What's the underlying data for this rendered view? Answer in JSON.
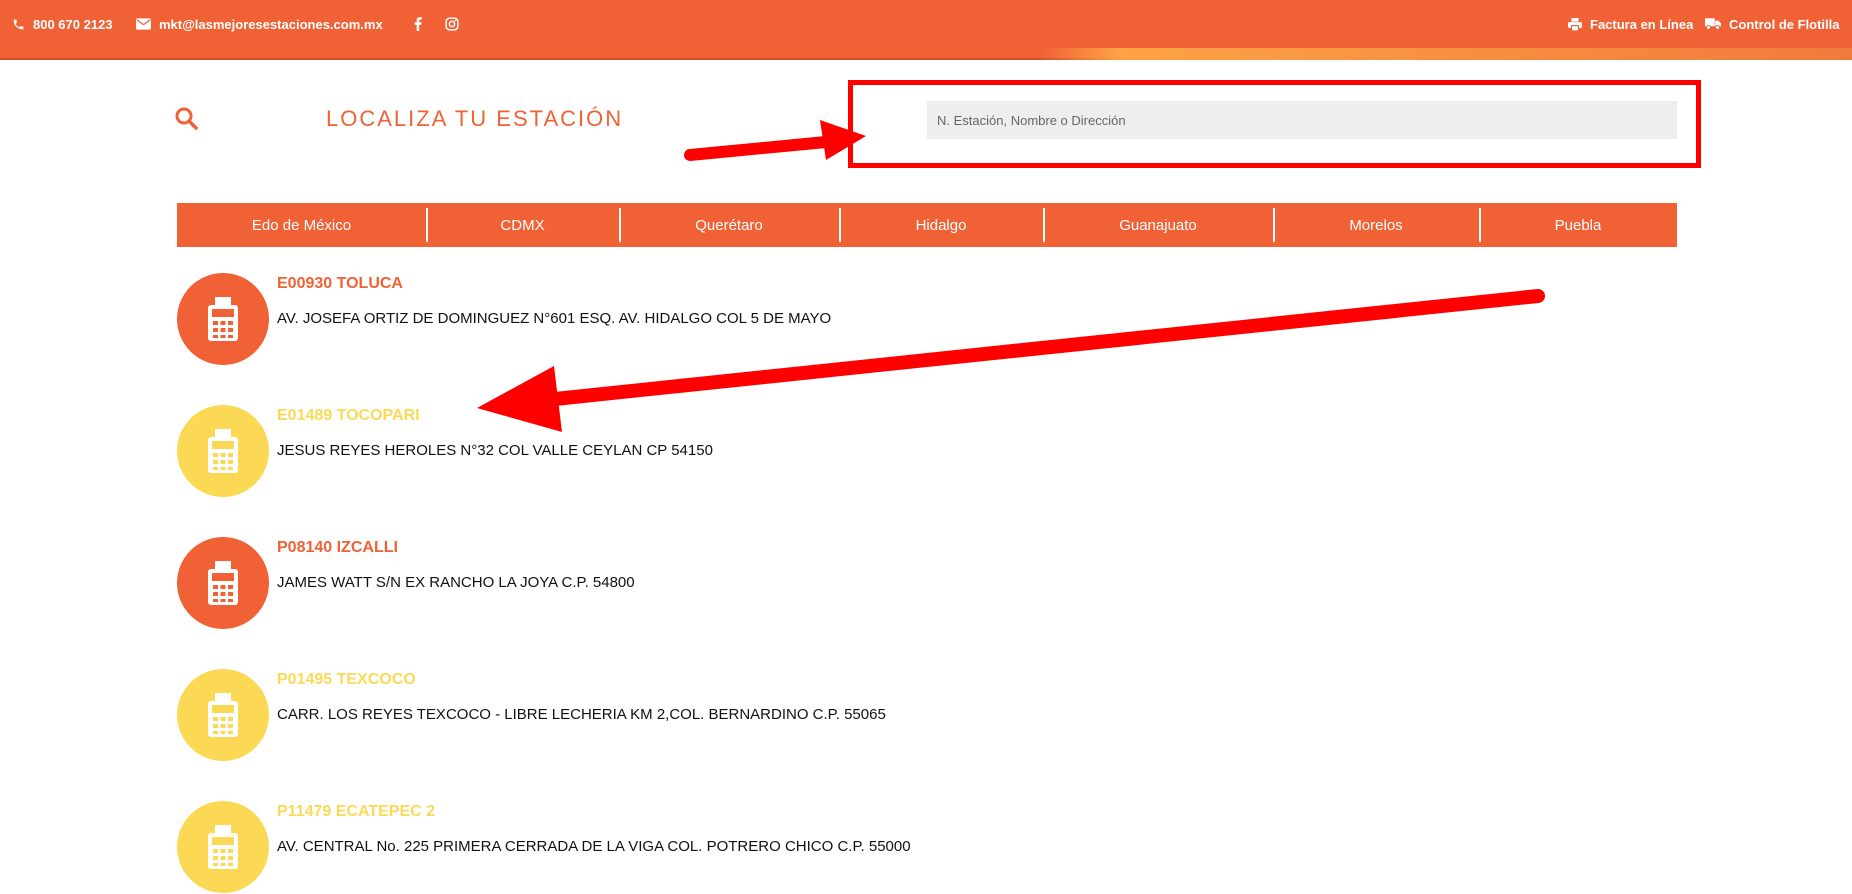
{
  "topbar": {
    "phone": "800 670 2123",
    "email": "mkt@lasmejoresestaciones.com.mx",
    "social": [
      "facebook-icon",
      "instagram-icon"
    ],
    "factura_label": "Factura en Línea",
    "flotilla_label": "Control de Flotilla"
  },
  "header": {
    "title": "LOCALIZA TU ESTACIÓN",
    "search_placeholder": "N. Estación, Nombre o Dirección"
  },
  "tabs": [
    "Edo de México",
    "CDMX",
    "Querétaro",
    "Hidalgo",
    "Guanajuato",
    "Morelos",
    "Puebla"
  ],
  "stations": [
    {
      "name": "E00930 TOLUCA",
      "address": "AV. JOSEFA ORTIZ DE DOMINGUEZ N°601 ESQ. AV. HIDALGO COL 5 DE MAYO",
      "color": "#f06136"
    },
    {
      "name": "E01489 TOCOPARI",
      "address": "JESUS REYES HEROLES N°32 COL VALLE CEYLAN CP 54150",
      "color": "#fcd955"
    },
    {
      "name": "P08140 IZCALLI",
      "address": "JAMES WATT S/N EX RANCHO LA JOYA C.P. 54800",
      "color": "#f06136"
    },
    {
      "name": "P01495 TEXCOCO",
      "address": "CARR. LOS REYES TEXCOCO - LIBRE LECHERIA KM 2,COL. BERNARDINO C.P. 55065",
      "color": "#fcd955"
    },
    {
      "name": "P11479 ECATEPEC 2",
      "address": "AV. CENTRAL No. 225 PRIMERA CERRADA DE LA VIGA COL. POTRERO CHICO C.P. 55000",
      "color": "#fcd955"
    }
  ],
  "colors": {
    "brand_orange": "#f06136",
    "accent_yellow": "#fcd955",
    "annotation_red": "#ff0000"
  }
}
